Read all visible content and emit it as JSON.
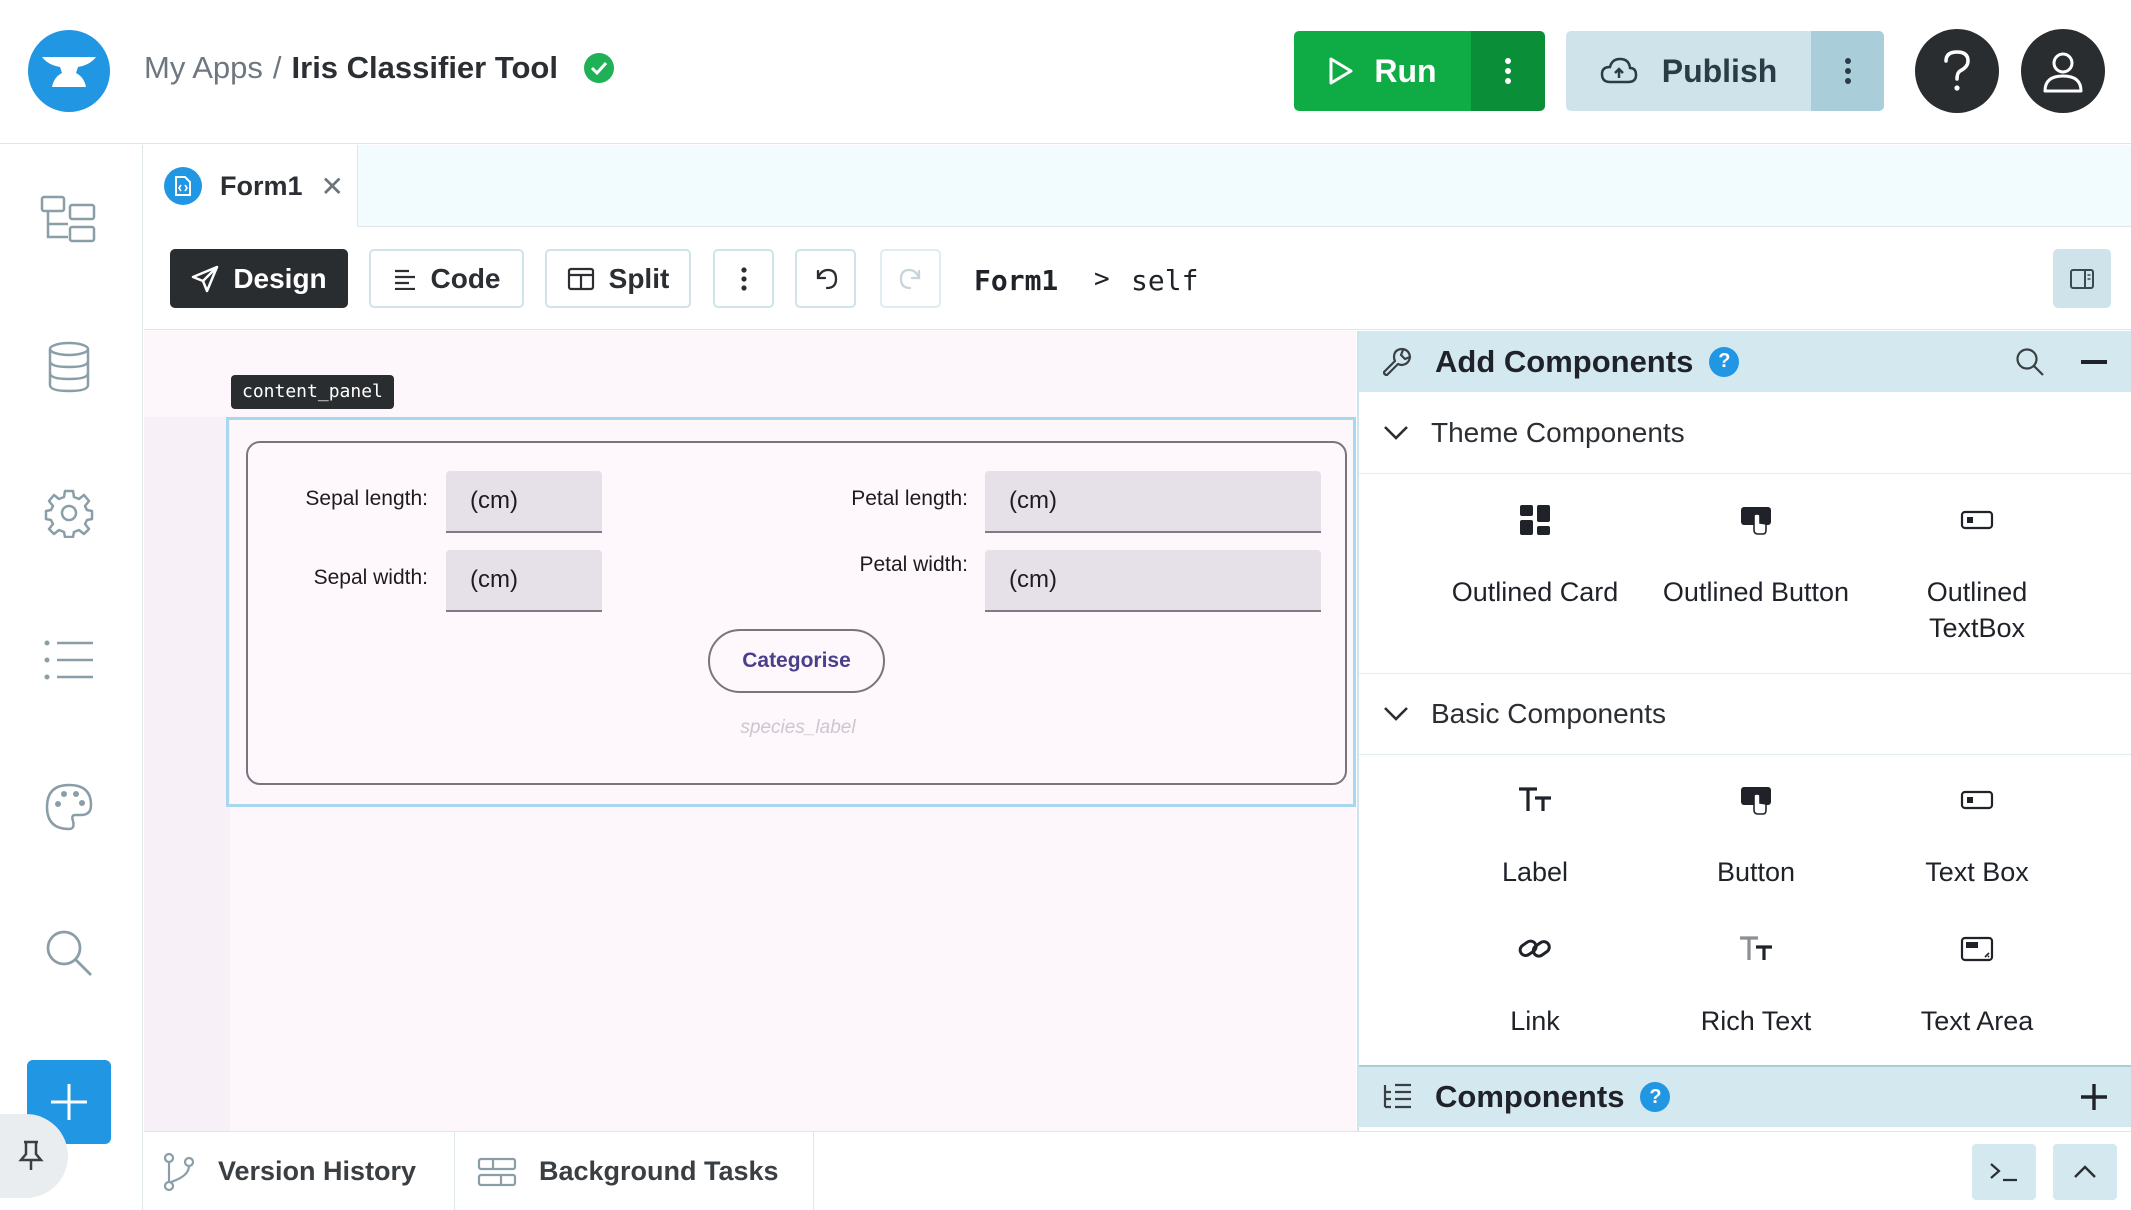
{
  "header": {
    "breadcrumb_root": "My Apps",
    "breadcrumb_sep": "/",
    "app_name": "Iris Classifier Tool",
    "run_label": "Run",
    "publish_label": "Publish"
  },
  "tabs": [
    {
      "label": "Form1"
    }
  ],
  "toolbar": {
    "design_label": "Design",
    "code_label": "Code",
    "split_label": "Split",
    "path_form": "Form1",
    "path_sep": ">",
    "path_self": "self"
  },
  "canvas": {
    "panel_tag": "content_panel",
    "sepal_length_label": "Sepal length:",
    "sepal_length_placeholder": "(cm)",
    "sepal_width_label": "Sepal width:",
    "sepal_width_placeholder": "(cm)",
    "petal_length_label": "Petal length:",
    "petal_length_placeholder": "(cm)",
    "petal_width_label": "Petal width:",
    "petal_width_placeholder": "(cm)",
    "categorise_label": "Categorise",
    "species_label": "species_label"
  },
  "add_components": {
    "title": "Add Components",
    "help": "?",
    "theme_section": "Theme Components",
    "theme_items": [
      {
        "label": "Outlined Card",
        "icon": "outlined-card-icon"
      },
      {
        "label": "Outlined Button",
        "icon": "outlined-button-icon"
      },
      {
        "label": "Outlined TextBox",
        "icon": "outlined-textbox-icon"
      }
    ],
    "basic_section": "Basic Components",
    "basic_items": [
      {
        "label": "Label",
        "icon": "label-icon"
      },
      {
        "label": "Button",
        "icon": "button-icon"
      },
      {
        "label": "Text Box",
        "icon": "text-box-icon"
      },
      {
        "label": "Link",
        "icon": "link-icon"
      },
      {
        "label": "Rich Text",
        "icon": "rich-text-icon"
      },
      {
        "label": "Text Area",
        "icon": "text-area-icon"
      }
    ]
  },
  "components_panel": {
    "title": "Components",
    "help": "?"
  },
  "bottom": {
    "version_history": "Version History",
    "background_tasks": "Background Tasks"
  },
  "colors": {
    "brand_blue": "#2196e3",
    "run_green": "#0fac45",
    "publish_bg": "#cfe3ea",
    "dark": "#2a2d30"
  }
}
